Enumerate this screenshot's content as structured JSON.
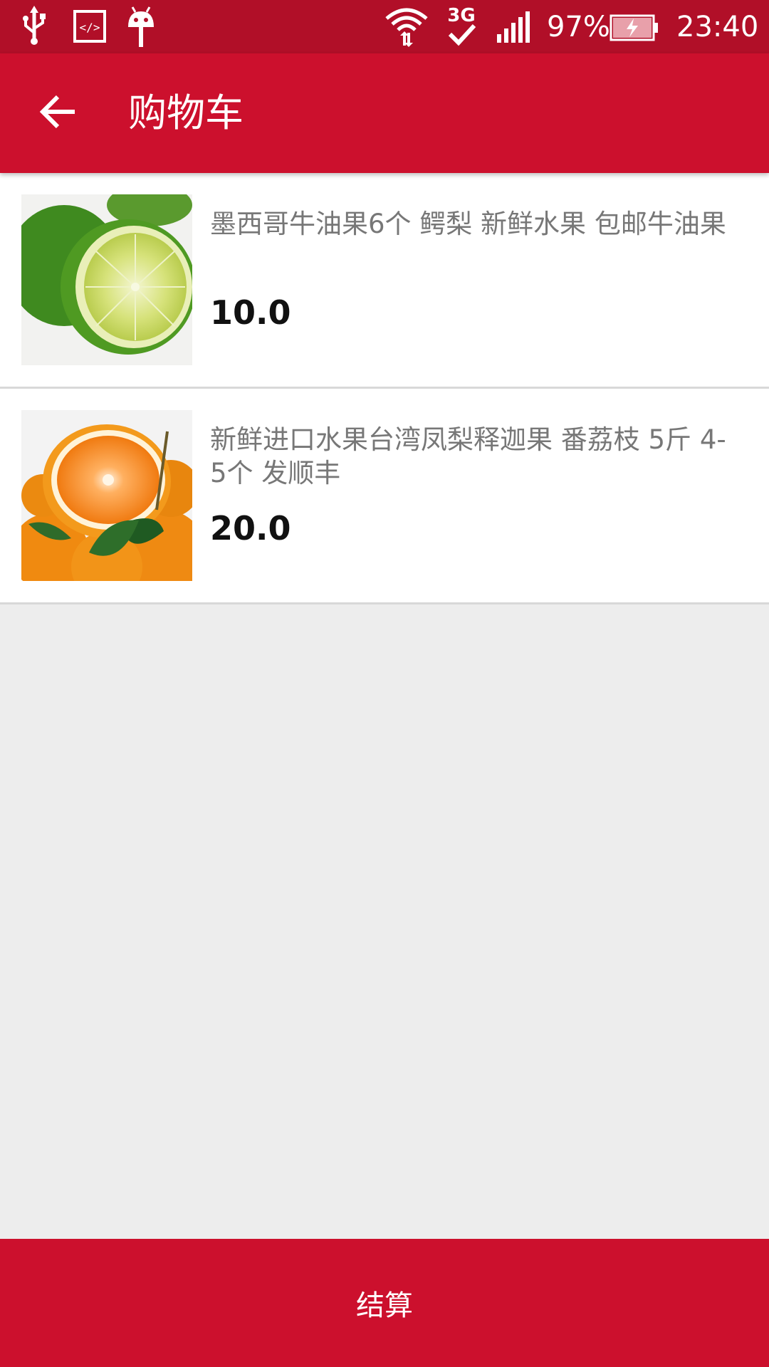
{
  "status_bar": {
    "battery": "97%",
    "time": "23:40",
    "network": "3G",
    "icons": [
      "usb-icon",
      "developer-code-icon",
      "android-icon",
      "wifi-icon",
      "network-3g-icon",
      "signal-icon",
      "battery-charging-icon"
    ]
  },
  "app_bar": {
    "title": "购物车",
    "back_icon": "arrow-back-icon"
  },
  "cart": {
    "items": [
      {
        "name": "墨西哥牛油果6个 鳄梨 新鲜水果 包邮牛油果",
        "price": "10.0",
        "image": "lime-image"
      },
      {
        "name": "新鲜进口水果台湾凤梨释迦果 番荔枝 5斤 4-5个 发顺丰",
        "price": "20.0",
        "image": "orange-image"
      }
    ]
  },
  "checkout": {
    "label": "结算"
  },
  "colors": {
    "primary": "#cc102d",
    "status_bar": "#b10f28",
    "background": "#ededed",
    "item_name": "#777777",
    "price": "#111111"
  }
}
